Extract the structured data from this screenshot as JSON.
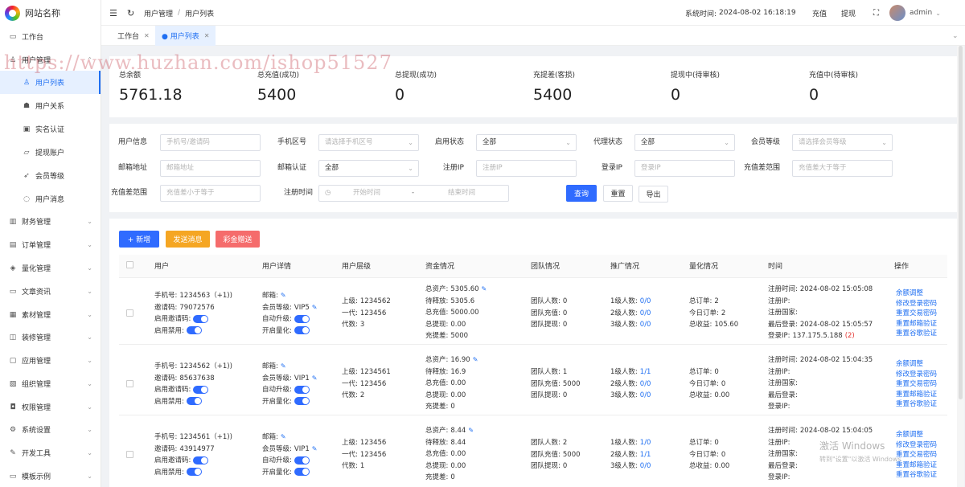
{
  "site_name": "网站名称",
  "menu": [
    {
      "label": "工作台",
      "icon": "▭"
    },
    {
      "label": "用户管理",
      "icon": "♙",
      "expanded": true
    },
    {
      "label": "用户列表",
      "icon": "♙",
      "sub": true,
      "active": true
    },
    {
      "label": "用户关系",
      "icon": "☗",
      "sub": true
    },
    {
      "label": "实名认证",
      "icon": "▣",
      "sub": true
    },
    {
      "label": "提现账户",
      "icon": "▱",
      "sub": true
    },
    {
      "label": "会员等级",
      "icon": "➶",
      "sub": true
    },
    {
      "label": "用户消息",
      "icon": "◌",
      "sub": true
    },
    {
      "label": "财务管理",
      "icon": "▥"
    },
    {
      "label": "订单管理",
      "icon": "▤"
    },
    {
      "label": "量化管理",
      "icon": "◈"
    },
    {
      "label": "文章资讯",
      "icon": "▭"
    },
    {
      "label": "素材管理",
      "icon": "▦"
    },
    {
      "label": "装修管理",
      "icon": "◫"
    },
    {
      "label": "应用管理",
      "icon": "▢"
    },
    {
      "label": "组织管理",
      "icon": "▧"
    },
    {
      "label": "权限管理",
      "icon": "◘"
    },
    {
      "label": "系统设置",
      "icon": "⚙"
    },
    {
      "label": "开发工具",
      "icon": "✎"
    },
    {
      "label": "模板示例",
      "icon": "▭"
    }
  ],
  "header": {
    "breadcrumb_root": "用户管理",
    "breadcrumb_sep": "/",
    "breadcrumb_current": "用户列表",
    "system_time_label": "系统时间:",
    "system_time": "2024-08-02 16:18:19",
    "recharge": "充值",
    "withdraw": "提现",
    "username": "admin"
  },
  "tabs": [
    {
      "label": "工作台"
    },
    {
      "label": "● 用户列表",
      "active": true
    }
  ],
  "watermark": "https://www.huzhan.com/ishop51527",
  "stats": [
    {
      "label": "总余额",
      "value": "5761.18"
    },
    {
      "label": "总充值(成功)",
      "value": "5400"
    },
    {
      "label": "总提现(成功)",
      "value": "0"
    },
    {
      "label": "充提差(客损)",
      "value": "5400"
    },
    {
      "label": "提现中(待审核)",
      "value": "0"
    },
    {
      "label": "充值中(待审核)",
      "value": "0"
    }
  ],
  "filters": [
    {
      "label": "用户信息",
      "placeholder": "手机号/邀请码"
    },
    {
      "label": "手机区号",
      "placeholder": "请选择手机区号",
      "select": true
    },
    {
      "label": "启用状态",
      "value": "全部",
      "select": true
    },
    {
      "label": "代理状态",
      "value": "全部",
      "select": true
    },
    {
      "label": "会员等级",
      "placeholder": "请选择会员等级",
      "select": true
    },
    {
      "label": "邮箱地址",
      "placeholder": "邮箱地址"
    },
    {
      "label": "邮箱认证",
      "value": "全部",
      "select": true
    },
    {
      "label": "注册IP",
      "placeholder": "注册IP"
    },
    {
      "label": "登录IP",
      "placeholder": "登录IP"
    },
    {
      "label": "充值差范围",
      "placeholder": "充值差大于等于"
    },
    {
      "label": "充值差范围",
      "placeholder": "充值差小于等于"
    }
  ],
  "date_filter": {
    "label": "注册时间",
    "start": "开始时间",
    "sep": "-",
    "end": "结束时间"
  },
  "filter_buttons": {
    "query": "查询",
    "reset": "重置",
    "export": "导出"
  },
  "actions": {
    "add": "+ 新增",
    "message": "发送消息",
    "gift": "彩金赠送"
  },
  "columns": [
    "用户",
    "用户详情",
    "用户层级",
    "资金情况",
    "团队情况",
    "推广情况",
    "量化情况",
    "时间",
    "操作"
  ],
  "labels": {
    "phone": "手机号:",
    "invite_code": "邀请码:",
    "invite_enabled": "启用邀请码:",
    "ban_enabled": "启用禁用:",
    "email": "邮箱:",
    "member_level": "会员等级:",
    "auto_upgrade": "自动升级:",
    "enable_quant": "开启量化:",
    "superior": "上级:",
    "gen1": "一代:",
    "generation": "代数:",
    "total_assets": "总资产:",
    "pending_release": "待释放:",
    "total_recharge": "总充值:",
    "total_withdraw": "总提现:",
    "recharge_diff": "充提差:",
    "team_count": "团队人数:",
    "team_recharge": "团队充值:",
    "team_withdraw": "团队提现:",
    "lv1": "1级人数:",
    "lv2": "2级人数:",
    "lv3": "3级人数:",
    "total_orders": "总订单:",
    "today_orders": "今日订单:",
    "total_income": "总收益:",
    "reg_time": "注册时间:",
    "reg_ip": "注册IP:",
    "reg_country": "注册国家:",
    "last_login": "最后登录:",
    "login_ip": "登录IP:"
  },
  "ops": [
    "余额调整",
    "修改登录密码",
    "重置交易密码",
    "重置邮箱验证",
    "重置谷歌验证"
  ],
  "users": [
    {
      "phone": "1234563（+1))",
      "invite": "79072576",
      "level": "VIP5",
      "superior": "1234562",
      "gen1": "123456",
      "generation": "3",
      "assets": "5305.60",
      "pending": "5305.6",
      "recharge": "5000.00",
      "withdraw": "0.00",
      "diff": "5000",
      "team_count": "0",
      "team_recharge": "0",
      "team_withdraw": "0",
      "lv1": "0/0",
      "lv2": "0/0",
      "lv3": "0/0",
      "orders": "2",
      "today": "2",
      "income": "105.60",
      "reg_time": "2024-08-02 15:05:08",
      "reg_ip": "",
      "country": "",
      "last_login": "2024-08-02 15:05:57",
      "login_ip": "137.175.5.188",
      "login_count": "(2)"
    },
    {
      "phone": "1234562（+1))",
      "invite": "85637638",
      "level": "VIP1",
      "superior": "1234561",
      "gen1": "123456",
      "generation": "2",
      "assets": "16.90",
      "pending": "16.9",
      "recharge": "0.00",
      "withdraw": "0.00",
      "diff": "0",
      "team_count": "1",
      "team_recharge": "5000",
      "team_withdraw": "0",
      "lv1": "1/1",
      "lv2": "0/0",
      "lv3": "0/0",
      "orders": "0",
      "today": "0",
      "income": "0.00",
      "reg_time": "2024-08-02 15:04:35",
      "reg_ip": "",
      "country": "",
      "last_login": "",
      "login_ip": "",
      "login_count": ""
    },
    {
      "phone": "1234561（+1))",
      "invite": "43914977",
      "level": "VIP1",
      "superior": "123456",
      "gen1": "123456",
      "generation": "1",
      "assets": "8.44",
      "pending": "8.44",
      "recharge": "0.00",
      "withdraw": "0.00",
      "diff": "0",
      "team_count": "2",
      "team_recharge": "5000",
      "team_withdraw": "0",
      "lv1": "1/0",
      "lv2": "1/1",
      "lv3": "0/0",
      "orders": "0",
      "today": "0",
      "income": "0.00",
      "reg_time": "2024-08-02 15:04:05",
      "reg_ip": "",
      "country": "",
      "last_login": "",
      "login_ip": "",
      "login_count": ""
    }
  ],
  "windows_activation": {
    "line1": "激活 Windows",
    "line2": "转到\"设置\"以激活 Windows"
  }
}
